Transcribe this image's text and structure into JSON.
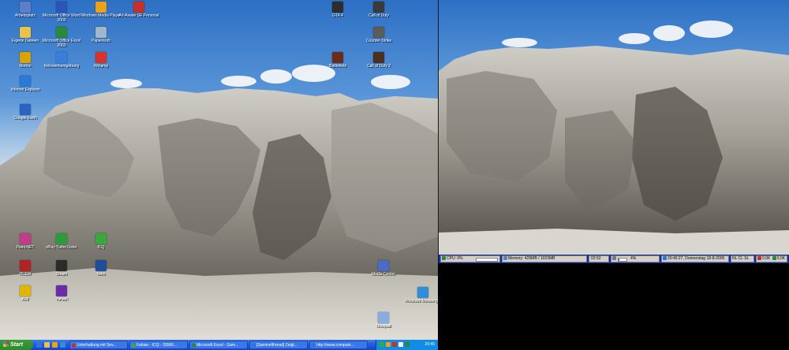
{
  "desktop_left": {
    "icons": [
      {
        "label": "Arbeitsplatz",
        "icon": "computer-icon",
        "color": "#5d7fc9"
      },
      {
        "label": "Microsoft Office Word 2003",
        "icon": "word-icon",
        "color": "#2b55b8"
      },
      {
        "label": "Windows Media Player",
        "icon": "media-player-icon",
        "color": "#e9a21c"
      },
      {
        "label": "Ad-Aware SE Personal",
        "icon": "adaware-icon",
        "color": "#c4302b"
      },
      {
        "label": "Eigene Dateien",
        "icon": "my-documents-icon",
        "color": "#e8c24a"
      },
      {
        "label": "Microsoft Office Excel 2003",
        "icon": "excel-icon",
        "color": "#2a8a3a"
      },
      {
        "label": "Papierkorb",
        "icon": "recycle-bin-icon",
        "color": "#9fb7c8"
      },
      {
        "label": "Norton",
        "icon": "norton-icon",
        "color": "#d9a400"
      },
      {
        "label": "Netzwerkumgebung",
        "icon": "network-icon",
        "color": "#3b7dd8"
      },
      {
        "label": "Winamp",
        "icon": "winamp-icon",
        "color": "#d8322c"
      },
      {
        "label": "Internet Explorer",
        "icon": "ie-icon",
        "color": "#2a79d6"
      },
      {
        "label": "Google Earth",
        "icon": "google-earth-icon",
        "color": "#2a63c4"
      },
      {
        "label": "Paint.NET",
        "icon": "paint-icon",
        "color": "#c33b8a"
      },
      {
        "label": "eBay Turbo Lister",
        "icon": "ebay-icon",
        "color": "#2c9b3a"
      },
      {
        "label": "ICQ",
        "icon": "icq-icon",
        "color": "#39a93b"
      },
      {
        "label": "HLSW",
        "icon": "hlsw-icon",
        "color": "#b42323"
      },
      {
        "label": "Steam",
        "icon": "steam-icon",
        "color": "#2b2b2b"
      },
      {
        "label": "Nero",
        "icon": "nero-icon",
        "color": "#1f4d9c"
      },
      {
        "label": "AIM",
        "icon": "aim-icon",
        "color": "#e0b500"
      },
      {
        "label": "Yahoo!",
        "icon": "yahoo-icon",
        "color": "#6b2ca8"
      }
    ],
    "right_icons": [
      {
        "label": "GTA 4",
        "icon": "gta-icon",
        "color": "#2d2d2d"
      },
      {
        "label": "Call of Duty",
        "icon": "cod-icon",
        "color": "#3a3a3a"
      },
      {
        "label": "Counter-Strike",
        "icon": "counter-strike-icon",
        "color": "#5b5b5b"
      },
      {
        "label": "Call of Duty 2",
        "icon": "cod2-icon",
        "color": "#4a3020"
      },
      {
        "label": "Battlefield",
        "icon": "battlefield-icon",
        "color": "#6b2c1a"
      },
      {
        "label": "Media Center",
        "icon": "media-center-icon",
        "color": "#4a6bc6"
      },
      {
        "label": "Windows Messenger",
        "icon": "messenger-icon",
        "color": "#2f8fd8"
      },
      {
        "label": "Notepad",
        "icon": "notepad-icon",
        "color": "#86aee0"
      }
    ]
  },
  "taskbar": {
    "start_label": "Start",
    "tasks": [
      {
        "label": "Unterhaltung mit Sev...",
        "color": "#c4302b"
      },
      {
        "label": "Fabian - ICQ - 33566...",
        "color": "#39a93b"
      },
      {
        "label": "Microsoft Excel - Gam...",
        "color": "#2a8a3a"
      },
      {
        "label": "[Sammelthread] Zeigt...",
        "color": "#2a79d6"
      },
      {
        "label": "http://www.compute...",
        "color": "#2a79d6"
      }
    ],
    "clock": "20:45"
  },
  "meters": {
    "cpu_label": "CPU: 0%",
    "cpu_level": 0.0,
    "memory_label": "Memory: 429MB / 1023MB",
    "memory_level": 0.42,
    "uptime": "02:52",
    "disk_label": "4%",
    "disk_level": 0.04,
    "datetime": "20:45:27, Donnerstag 18-8-2005",
    "locks": [
      "NL",
      "CL",
      "SL"
    ],
    "net_down": "0,0K",
    "net_up": "0,0K"
  }
}
